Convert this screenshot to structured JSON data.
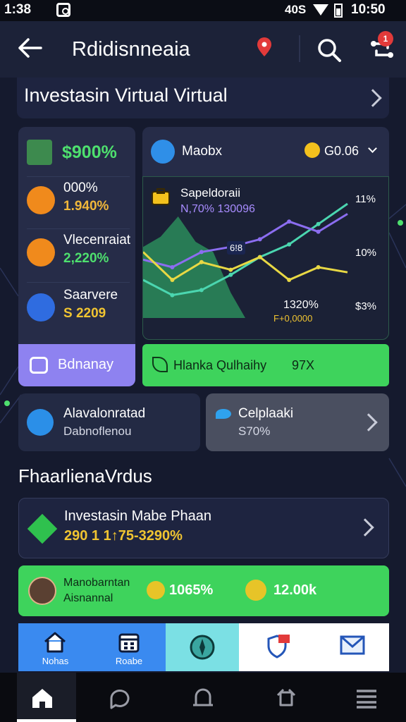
{
  "status_bar": {
    "time": "1:38",
    "network": "40S",
    "clock": "10:50"
  },
  "app_bar": {
    "title": "Rdidisnneaia",
    "badge": "1"
  },
  "headline": {
    "text": "Investasin Virtual Virtual"
  },
  "left_panel": {
    "top_value": "$900%",
    "items": [
      {
        "label": "000%",
        "value": "1.940%",
        "value_color": "#f0b73a",
        "icon_color": "#f08a1c"
      },
      {
        "label": "Vlecenraiat",
        "value": "2,220%",
        "value_color": "#4ee06e",
        "icon_color": "#f08a1c"
      },
      {
        "label": "Saarvere",
        "value": "S 2209",
        "value_color": "#f0c431",
        "icon_color": "#2f6ce0"
      }
    ],
    "button_label": "Bdnanay"
  },
  "chart_card": {
    "asset_name": "Maobx",
    "price": "G0.06",
    "series_label": "Sapeldoraii",
    "series_values": "N,70% 130096",
    "badge": "6!8",
    "point_value": "1320%",
    "point_sub": "F+0,0000",
    "right_labels": [
      "11%",
      "10%",
      "$3%"
    ]
  },
  "chart_data": {
    "type": "line",
    "series": [
      {
        "color": "#4bd6b0",
        "values": [
          30,
          18,
          22,
          34,
          48,
          58,
          74,
          90
        ]
      },
      {
        "color": "#8b6df0",
        "values": [
          46,
          40,
          52,
          56,
          62,
          76,
          68,
          82
        ]
      },
      {
        "color": "#e8d844",
        "values": [
          52,
          30,
          44,
          38,
          48,
          30,
          40,
          36
        ]
      }
    ],
    "area_color": "#2e9a60"
  },
  "green_bar": {
    "label": "Hlanka Qulhaihy",
    "value": "97X"
  },
  "mini_cards": [
    {
      "title": "Alavalonratad",
      "subtitle": "Dabnoflenou"
    },
    {
      "title": "Celplaaki",
      "subtitle": "S70%"
    }
  ],
  "section": {
    "title": "FhaarlienaVrdus"
  },
  "invest_card": {
    "title": "Investasin Mabe Phaan",
    "value": "290 1 1↑75-3290%"
  },
  "promo": {
    "line1": "Manobarntan",
    "line2": "Aisnannal",
    "value1": "1065%",
    "value2": "12.00k"
  },
  "quick_tabs": [
    {
      "label": "Nohas",
      "bg": "#3a8af0"
    },
    {
      "label": "Roabe",
      "bg": "#3a8af0"
    },
    {
      "label": "",
      "bg": "#7be0e4"
    },
    {
      "label": "",
      "bg": "#ffffff"
    },
    {
      "label": "",
      "bg": "#ffffff"
    }
  ]
}
